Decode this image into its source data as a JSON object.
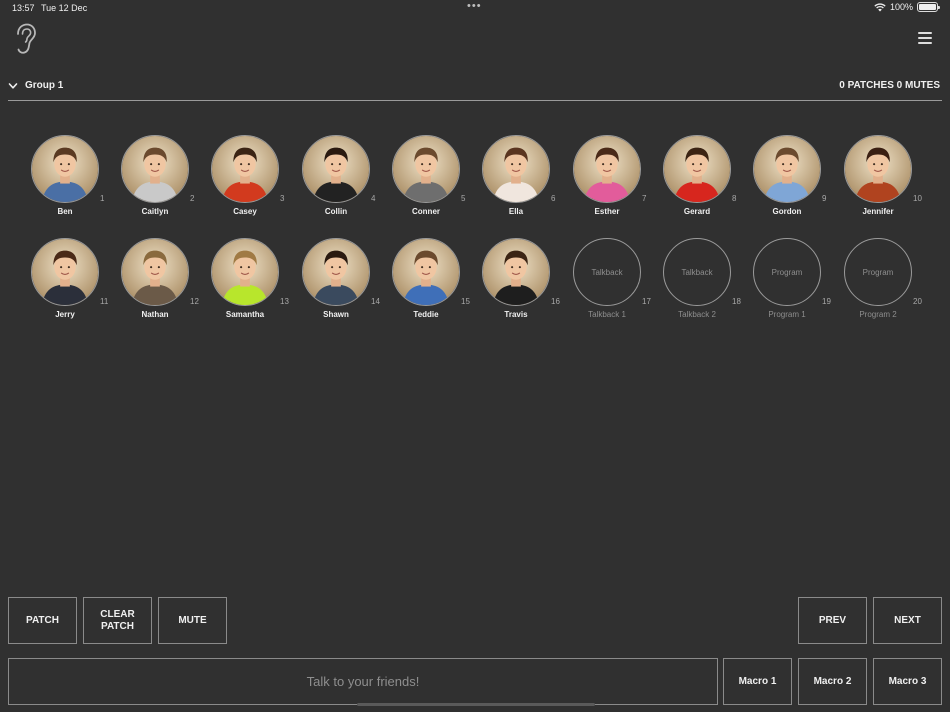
{
  "status_bar": {
    "time": "13:57",
    "date": "Tue 12 Dec",
    "battery": "100%",
    "battery_level": 1.0
  },
  "header": {
    "icon": "ear-icon",
    "menu_icon": "hamburger-menu-icon"
  },
  "group": {
    "title": "Group 1",
    "stats": "0 PATCHES 0 MUTES"
  },
  "tiles": [
    {
      "number": "1",
      "name": "Ben",
      "type": "person",
      "shirt": "#4a6fa5",
      "hair": "#5a3a22"
    },
    {
      "number": "2",
      "name": "Caitlyn",
      "type": "person",
      "shirt": "#c9c9c9",
      "hair": "#6b4a2e"
    },
    {
      "number": "3",
      "name": "Casey",
      "type": "person",
      "shirt": "#d23a1e",
      "hair": "#3b2414"
    },
    {
      "number": "4",
      "name": "Collin",
      "type": "person",
      "shirt": "#222222",
      "hair": "#2a1a10"
    },
    {
      "number": "5",
      "name": "Conner",
      "type": "person",
      "shirt": "#6e6e6e",
      "hair": "#6b4a2e"
    },
    {
      "number": "6",
      "name": "Ella",
      "type": "person",
      "shirt": "#f0e6de",
      "hair": "#5a3520"
    },
    {
      "number": "7",
      "name": "Esther",
      "type": "person",
      "shirt": "#e25c9b",
      "hair": "#4a2a18"
    },
    {
      "number": "8",
      "name": "Gerard",
      "type": "person",
      "shirt": "#d7261e",
      "hair": "#3b2414"
    },
    {
      "number": "9",
      "name": "Gordon",
      "type": "person",
      "shirt": "#7fa6d6",
      "hair": "#6b4a2e"
    },
    {
      "number": "10",
      "name": "Jennifer",
      "type": "person",
      "shirt": "#b0431f",
      "hair": "#3a1f12"
    },
    {
      "number": "11",
      "name": "Jerry",
      "type": "person",
      "shirt": "#2b2f3a",
      "hair": "#4a2a18"
    },
    {
      "number": "12",
      "name": "Nathan",
      "type": "person",
      "shirt": "#6b5a48",
      "hair": "#8a6a3e"
    },
    {
      "number": "13",
      "name": "Samantha",
      "type": "person",
      "shirt": "#b8e62c",
      "hair": "#a07a44"
    },
    {
      "number": "14",
      "name": "Shawn",
      "type": "person",
      "shirt": "#3a4a5e",
      "hair": "#2a1a10"
    },
    {
      "number": "15",
      "name": "Teddie",
      "type": "person",
      "shirt": "#3f6fb8",
      "hair": "#6b4a2e"
    },
    {
      "number": "16",
      "name": "Travis",
      "type": "person",
      "shirt": "#1e1e1e",
      "hair": "#3b2414"
    },
    {
      "number": "17",
      "name": "Talkback 1",
      "type": "channel",
      "label": "Talkback"
    },
    {
      "number": "18",
      "name": "Talkback 2",
      "type": "channel",
      "label": "Talkback"
    },
    {
      "number": "19",
      "name": "Program 1",
      "type": "channel",
      "label": "Program"
    },
    {
      "number": "20",
      "name": "Program 2",
      "type": "channel",
      "label": "Program"
    }
  ],
  "controls": {
    "patch": "PATCH",
    "clear_patch": "CLEAR PATCH",
    "mute": "MUTE",
    "prev": "PREV",
    "next": "NEXT"
  },
  "talk": {
    "placeholder": "Talk to your friends!"
  },
  "macros": [
    "Macro 1",
    "Macro 2",
    "Macro 3"
  ],
  "colors": {
    "background": "#303030",
    "border": "#8a8a8a",
    "text": "#f0f0f0",
    "dim_text": "#8e8e8e"
  }
}
